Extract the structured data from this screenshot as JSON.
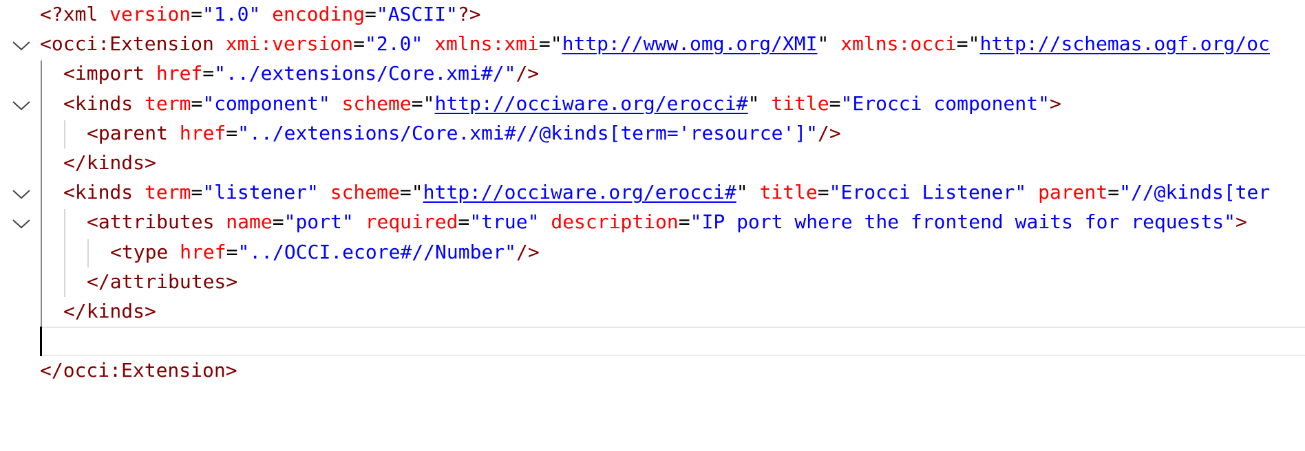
{
  "editor": {
    "lines": [
      {
        "indent": 0,
        "fold": false,
        "tokens": [
          {
            "t": "pi",
            "v": "<?xml "
          },
          {
            "t": "attr",
            "v": "version"
          },
          {
            "t": "eq",
            "v": "="
          },
          {
            "t": "val",
            "v": "\"1.0\""
          },
          {
            "t": "eq",
            "v": " "
          },
          {
            "t": "attr",
            "v": "encoding"
          },
          {
            "t": "eq",
            "v": "="
          },
          {
            "t": "val",
            "v": "\"ASCII\""
          },
          {
            "t": "pi",
            "v": "?>"
          }
        ]
      },
      {
        "indent": 0,
        "fold": true,
        "tokens": [
          {
            "t": "tag",
            "v": "<occi:Extension "
          },
          {
            "t": "attr",
            "v": "xmi:version"
          },
          {
            "t": "eq",
            "v": "="
          },
          {
            "t": "val",
            "v": "\"2.0\""
          },
          {
            "t": "eq",
            "v": " "
          },
          {
            "t": "attr",
            "v": "xmlns:xmi"
          },
          {
            "t": "eq",
            "v": "="
          },
          {
            "t": "q",
            "v": "\""
          },
          {
            "t": "link",
            "v": "http://www.omg.org/XMI"
          },
          {
            "t": "q",
            "v": "\""
          },
          {
            "t": "eq",
            "v": " "
          },
          {
            "t": "attr",
            "v": "xmlns:occi"
          },
          {
            "t": "eq",
            "v": "="
          },
          {
            "t": "q",
            "v": "\""
          },
          {
            "t": "link",
            "v": "http://schemas.ogf.org/oc"
          }
        ]
      },
      {
        "indent": 1,
        "fold": false,
        "tokens": [
          {
            "t": "tag",
            "v": "<import "
          },
          {
            "t": "attr",
            "v": "href"
          },
          {
            "t": "eq",
            "v": "="
          },
          {
            "t": "val",
            "v": "\"../extensions/Core.xmi#/\""
          },
          {
            "t": "tag",
            "v": "/>"
          }
        ]
      },
      {
        "indent": 1,
        "fold": true,
        "tokens": [
          {
            "t": "tag",
            "v": "<kinds "
          },
          {
            "t": "attr",
            "v": "term"
          },
          {
            "t": "eq",
            "v": "="
          },
          {
            "t": "val",
            "v": "\"component\""
          },
          {
            "t": "eq",
            "v": " "
          },
          {
            "t": "attr",
            "v": "scheme"
          },
          {
            "t": "eq",
            "v": "="
          },
          {
            "t": "q",
            "v": "\""
          },
          {
            "t": "link",
            "v": "http://occiware.org/erocci#"
          },
          {
            "t": "q",
            "v": "\""
          },
          {
            "t": "eq",
            "v": " "
          },
          {
            "t": "attr",
            "v": "title"
          },
          {
            "t": "eq",
            "v": "="
          },
          {
            "t": "val",
            "v": "\"Erocci component\""
          },
          {
            "t": "tag",
            "v": ">"
          }
        ]
      },
      {
        "indent": 2,
        "fold": false,
        "tokens": [
          {
            "t": "tag",
            "v": "<parent "
          },
          {
            "t": "attr",
            "v": "href"
          },
          {
            "t": "eq",
            "v": "="
          },
          {
            "t": "val",
            "v": "\"../extensions/Core.xmi#//@kinds[term='resource']\""
          },
          {
            "t": "tag",
            "v": "/>"
          }
        ]
      },
      {
        "indent": 1,
        "fold": false,
        "tokens": [
          {
            "t": "tag",
            "v": "</kinds>"
          }
        ]
      },
      {
        "indent": 1,
        "fold": true,
        "tokens": [
          {
            "t": "tag",
            "v": "<kinds "
          },
          {
            "t": "attr",
            "v": "term"
          },
          {
            "t": "eq",
            "v": "="
          },
          {
            "t": "val",
            "v": "\"listener\""
          },
          {
            "t": "eq",
            "v": " "
          },
          {
            "t": "attr",
            "v": "scheme"
          },
          {
            "t": "eq",
            "v": "="
          },
          {
            "t": "q",
            "v": "\""
          },
          {
            "t": "link",
            "v": "http://occiware.org/erocci#"
          },
          {
            "t": "q",
            "v": "\""
          },
          {
            "t": "eq",
            "v": " "
          },
          {
            "t": "attr",
            "v": "title"
          },
          {
            "t": "eq",
            "v": "="
          },
          {
            "t": "val",
            "v": "\"Erocci Listener\""
          },
          {
            "t": "eq",
            "v": " "
          },
          {
            "t": "attr",
            "v": "parent"
          },
          {
            "t": "eq",
            "v": "="
          },
          {
            "t": "val",
            "v": "\"//@kinds[ter"
          }
        ]
      },
      {
        "indent": 2,
        "fold": true,
        "tokens": [
          {
            "t": "tag",
            "v": "<attributes "
          },
          {
            "t": "attr",
            "v": "name"
          },
          {
            "t": "eq",
            "v": "="
          },
          {
            "t": "val",
            "v": "\"port\""
          },
          {
            "t": "eq",
            "v": " "
          },
          {
            "t": "attr",
            "v": "required"
          },
          {
            "t": "eq",
            "v": "="
          },
          {
            "t": "val",
            "v": "\"true\""
          },
          {
            "t": "eq",
            "v": " "
          },
          {
            "t": "attr",
            "v": "description"
          },
          {
            "t": "eq",
            "v": "="
          },
          {
            "t": "val",
            "v": "\"IP port where the frontend waits for requests\""
          },
          {
            "t": "tag",
            "v": ">"
          }
        ]
      },
      {
        "indent": 3,
        "fold": false,
        "tokens": [
          {
            "t": "tag",
            "v": "<type "
          },
          {
            "t": "attr",
            "v": "href"
          },
          {
            "t": "eq",
            "v": "="
          },
          {
            "t": "val",
            "v": "\"../OCCI.ecore#//Number\""
          },
          {
            "t": "tag",
            "v": "/>"
          }
        ]
      },
      {
        "indent": 2,
        "fold": false,
        "tokens": [
          {
            "t": "tag",
            "v": "</attributes>"
          }
        ]
      },
      {
        "indent": 1,
        "fold": false,
        "tokens": [
          {
            "t": "tag",
            "v": "</kinds>"
          }
        ]
      },
      {
        "indent": 1,
        "fold": false,
        "current": true,
        "tokens": []
      },
      {
        "indent": 0,
        "fold": false,
        "tokens": [
          {
            "t": "tag",
            "v": "</occi:Extension>"
          }
        ]
      }
    ]
  }
}
